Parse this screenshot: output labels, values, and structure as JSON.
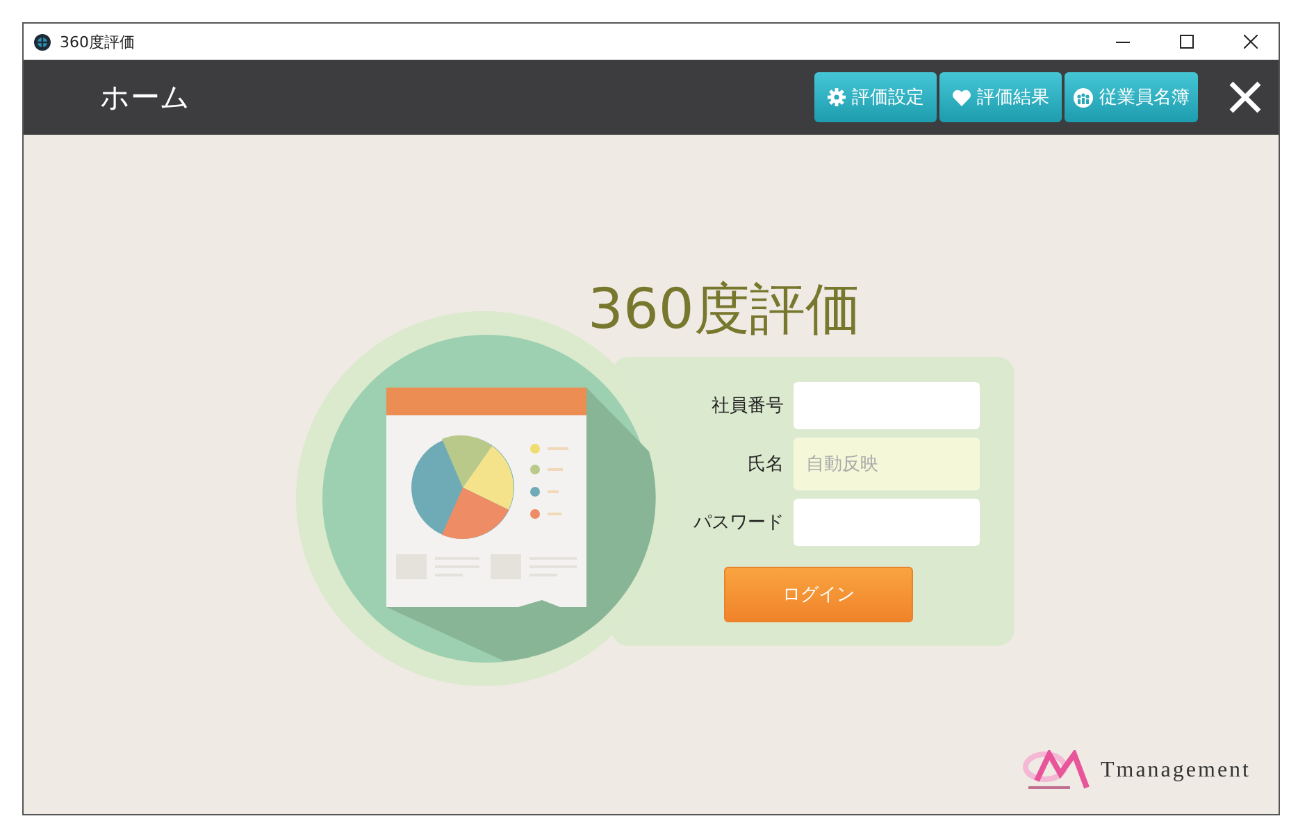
{
  "window": {
    "title": "360度評価"
  },
  "header": {
    "title": "ホーム",
    "buttons": [
      {
        "label": "評価設定",
        "kind": "settings"
      },
      {
        "label": "評価結果",
        "kind": "heart"
      },
      {
        "label": "従業員名簿",
        "kind": "people"
      }
    ]
  },
  "app_title": "360度評価",
  "form": {
    "fields": [
      {
        "label": "社員番号",
        "readonly": false
      },
      {
        "label": "氏名",
        "placeholder": "自動反映",
        "readonly": true
      },
      {
        "label": "パスワード",
        "readonly": false
      }
    ],
    "login_button": "ログイン"
  },
  "logo": {
    "text": "Tmanagement"
  }
}
